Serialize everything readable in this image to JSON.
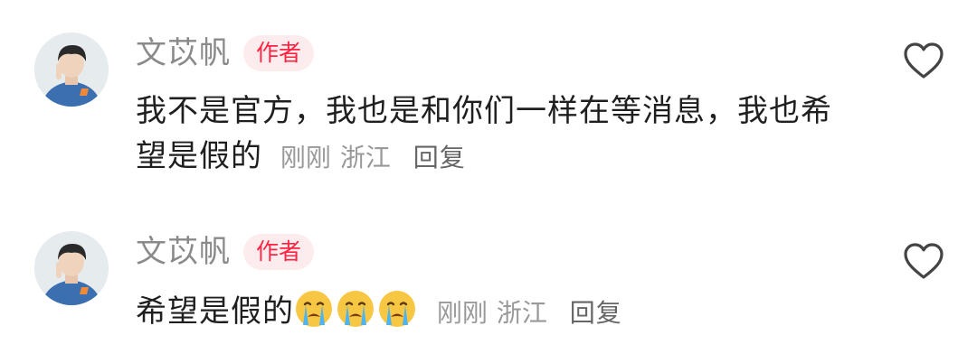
{
  "comments": [
    {
      "username": "文苡帆",
      "badge": "作者",
      "text": "我不是官方，我也是和你们一样在等消息，我也希望是假的",
      "time": "刚刚",
      "location": "浙江",
      "reply": "回复",
      "emojis": []
    },
    {
      "username": "文苡帆",
      "badge": "作者",
      "text": "希望是假的",
      "time": "刚刚",
      "location": "浙江",
      "reply": "回复",
      "emojis": [
        "crying-face",
        "crying-face",
        "crying-face"
      ]
    }
  ],
  "icons": {
    "like": "heart-outline-icon"
  },
  "colors": {
    "badge_text": "#ff2442",
    "badge_bg": "#fdecee",
    "username": "#8a8a8a",
    "meta": "#999999"
  }
}
